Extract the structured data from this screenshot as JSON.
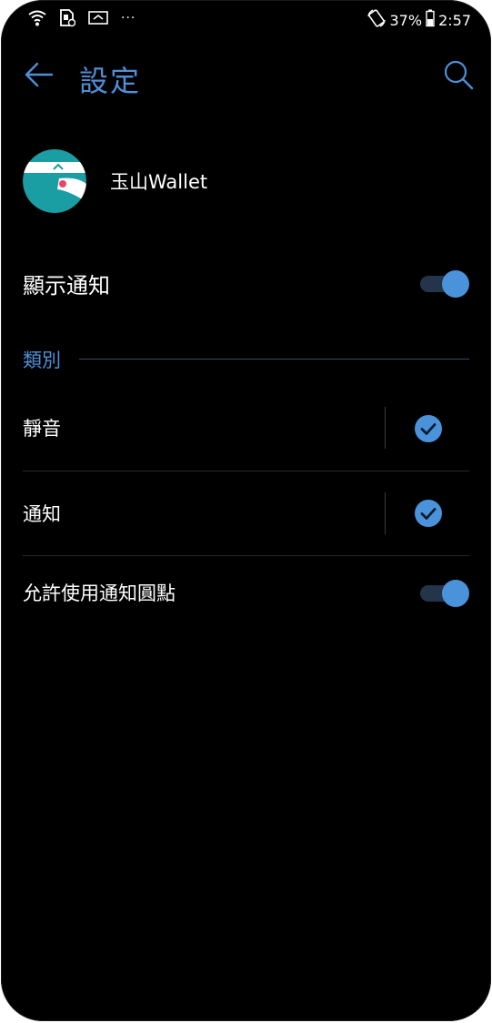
{
  "status_bar": {
    "battery_percent": "37%",
    "time": "2:57",
    "more_indicator": "···",
    "icons": [
      "wifi-icon",
      "sim-icon",
      "screencast-icon",
      "rotate-icon",
      "battery-icon"
    ]
  },
  "header": {
    "title": "設定",
    "back_icon": "arrow-left-icon",
    "search_icon": "search-icon"
  },
  "app": {
    "name": "玉山Wallet",
    "icon": "app-logo-icon"
  },
  "settings": {
    "show_notifications": {
      "label": "顯示通知",
      "enabled": true
    },
    "category_header": "類別",
    "categories": [
      {
        "label": "靜音",
        "checked": true
      },
      {
        "label": "通知",
        "checked": true
      }
    ],
    "allow_badge": {
      "label": "允許使用通知圓點",
      "enabled": true
    }
  },
  "colors": {
    "accent": "#4f8fd6",
    "toggle_thumb": "#4a93db",
    "toggle_track": "#24354b",
    "background": "#000000",
    "app_teal": "#1a9ea3"
  }
}
